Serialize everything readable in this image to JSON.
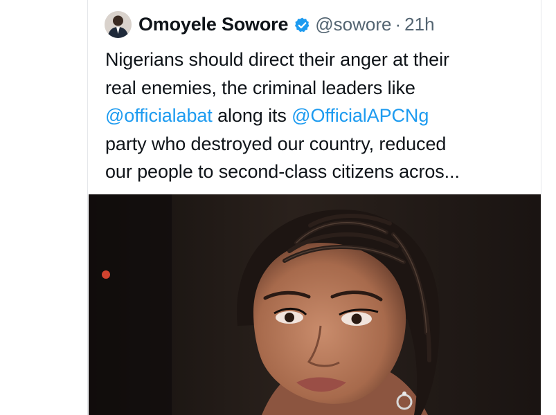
{
  "tweet": {
    "author": {
      "name": "Omoyele Sowore",
      "handle": "@sowore",
      "verified": true,
      "avatar_icon": "avatar-icon"
    },
    "separator": "·",
    "timestamp": "21h",
    "text_lines": [
      {
        "before": "Nigerians should direct their anger at their",
        "mention": "",
        "after": ""
      },
      {
        "before": "real enemies, the criminal leaders like",
        "mention": "",
        "after": ""
      },
      {
        "before": "",
        "mention": "@officialabat",
        "after": " along its "
      },
      {
        "before": "party who destroyed our country, reduced",
        "mention": "",
        "after": ""
      },
      {
        "before": "our people to second-class citizens acros...",
        "mention": "",
        "after": ""
      }
    ],
    "mention_2": "@OfficialAPCNg",
    "media": {
      "kind": "photo",
      "description_icon": "photo-woman-cornrows"
    }
  },
  "colors": {
    "text": "#0f1419",
    "secondary": "#536471",
    "mention": "#1d9bf0",
    "verified": "#1d9bf0",
    "border": "#e5e7ea"
  }
}
